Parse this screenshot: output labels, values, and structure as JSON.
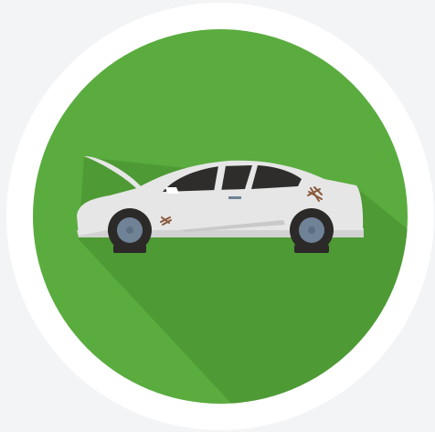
{
  "illustration": {
    "subject": "car-with-open-hood-icon",
    "colors": {
      "background": "#f3f4f6",
      "outer_ring": "#ffffff",
      "circle": "#5aac3f",
      "long_shadow": "#4e9a35",
      "car_body": "#e6e6e6",
      "car_lower": "#cfcfcf",
      "windows": "#2f2d2b",
      "tire": "#2b2a28",
      "rim": "#6f8296",
      "damage_marks": "#8a5a3c"
    },
    "icons": [
      "car-body-icon",
      "open-hood-icon",
      "flat-tire-icon",
      "damage-mark-icon"
    ]
  }
}
